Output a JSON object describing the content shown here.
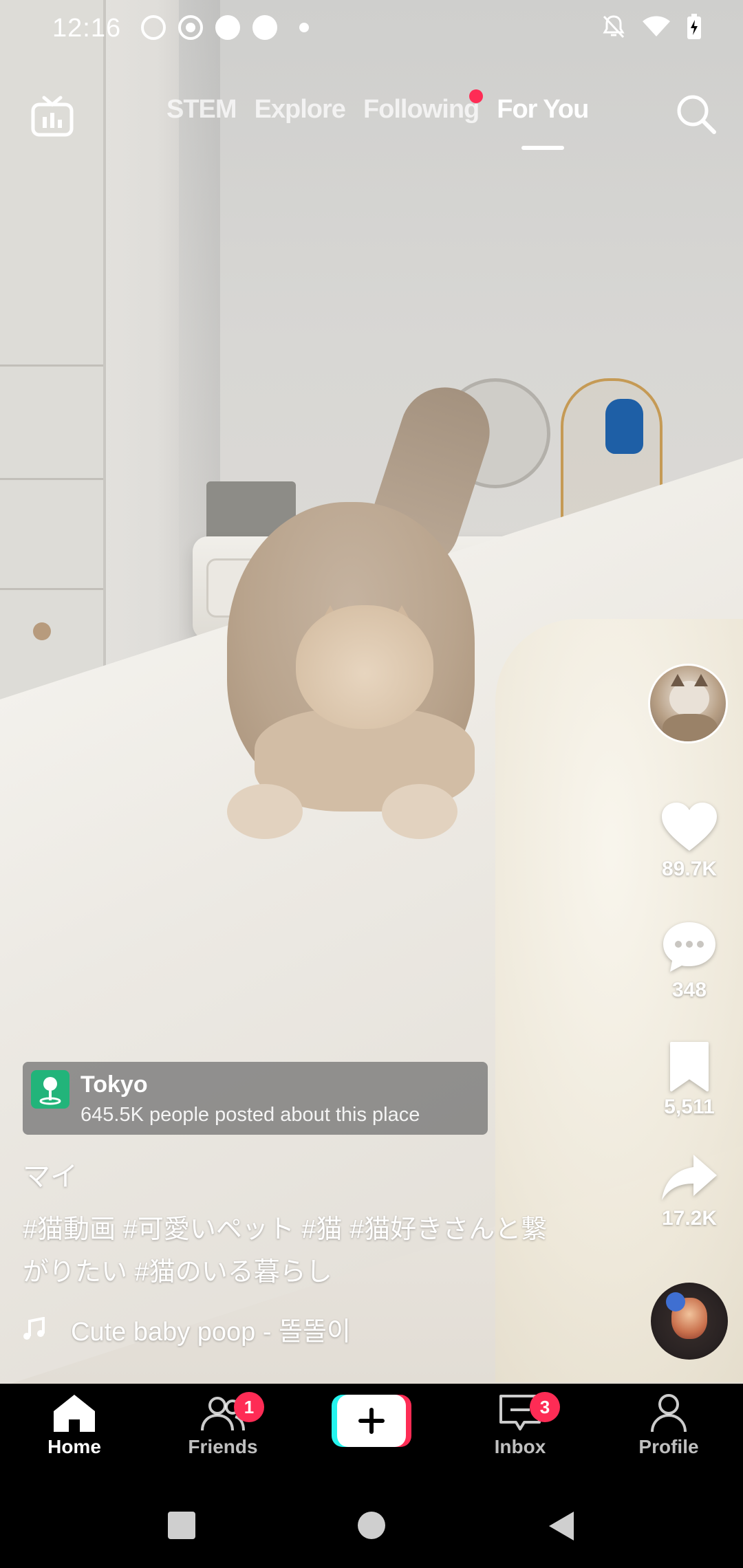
{
  "status_bar": {
    "time": "12:16",
    "left_icons": [
      "threads-icon",
      "record-icon",
      "pinterest-icon",
      "pinterest-icon",
      "dot-icon"
    ],
    "right_icons": [
      "mute-icon",
      "wifi-icon",
      "battery-charging-icon"
    ]
  },
  "top_nav": {
    "tabs": [
      {
        "label": "STEM",
        "active": false
      },
      {
        "label": "Explore",
        "active": false
      },
      {
        "label": "Following",
        "active": false,
        "has_dot": true
      },
      {
        "label": "For You",
        "active": true
      }
    ]
  },
  "actions": {
    "likes": "89.7K",
    "comments": "348",
    "saves": "5,511",
    "shares": "17.2K"
  },
  "post": {
    "location_title": "Tokyo",
    "location_subtitle": "645.5K people posted about this place",
    "username": "マイ",
    "caption": "#猫動画 #可愛いペット #猫 #猫好きさんと繋がりたい #猫のいる暮らし",
    "music": "Cute baby poop - 똘똘이"
  },
  "bottom_nav": {
    "home": "Home",
    "friends": "Friends",
    "friends_badge": "1",
    "inbox": "Inbox",
    "inbox_badge": "3",
    "profile": "Profile"
  },
  "colors": {
    "accent": "#fe2c55",
    "cyan": "#25f4ee",
    "location_green": "#22b47a"
  }
}
